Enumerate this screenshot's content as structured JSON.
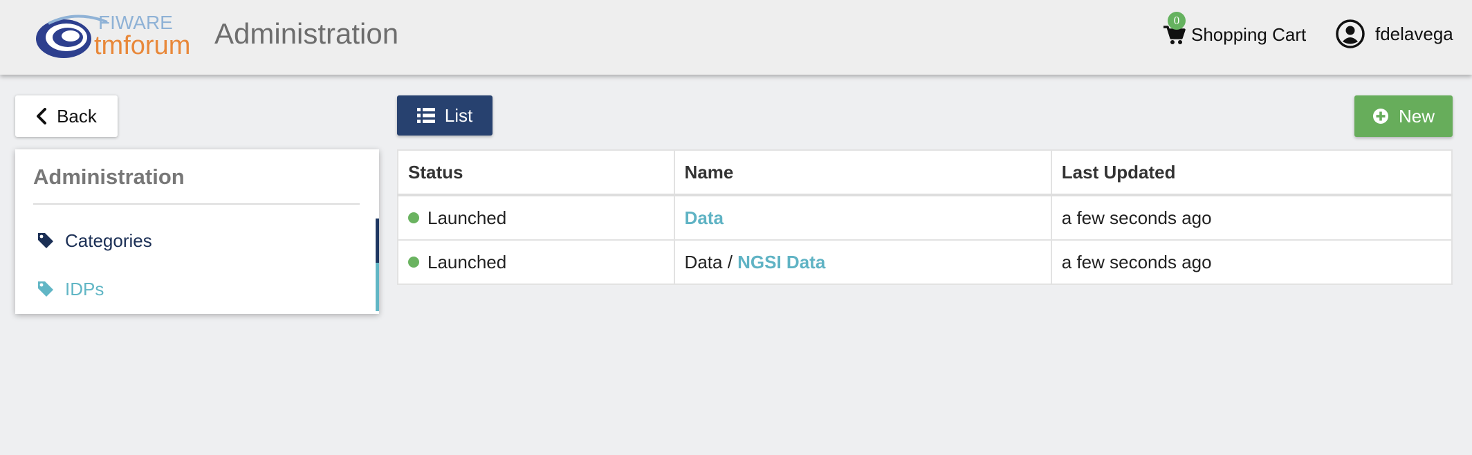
{
  "header": {
    "logo": {
      "line1": "FIWARE",
      "line2": "tmforum"
    },
    "title": "Administration",
    "cart": {
      "count": "0",
      "label": "Shopping Cart"
    },
    "user": {
      "name": "fdelavega"
    }
  },
  "toolbar": {
    "back_label": "Back",
    "list_label": "List",
    "new_label": "New"
  },
  "sidebar": {
    "title": "Administration",
    "items": [
      {
        "label": "Categories",
        "icon": "tag-icon"
      },
      {
        "label": "IDPs",
        "icon": "tag-icon"
      }
    ]
  },
  "table": {
    "headers": [
      "Status",
      "Name",
      "Last Updated"
    ],
    "rows": [
      {
        "status": "Launched",
        "name_prefix": "",
        "name_link": "Data",
        "updated": "a few seconds ago"
      },
      {
        "status": "Launched",
        "name_prefix": "Data / ",
        "name_link": "NGSI Data",
        "updated": "a few seconds ago"
      }
    ]
  },
  "colors": {
    "primary": "#27416f",
    "success": "#67ad5b",
    "link": "#5fb3c4",
    "status_launched": "#6ab360"
  }
}
